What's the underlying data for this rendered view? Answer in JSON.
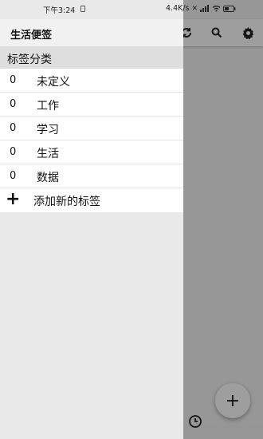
{
  "status_bar": {
    "time": "下午3:24",
    "network_speed": "4.4K/s"
  },
  "drawer": {
    "title": "生活便签",
    "section_title": "标签分类",
    "tags": [
      {
        "count": "0",
        "label": "未定义"
      },
      {
        "count": "0",
        "label": "工作"
      },
      {
        "count": "0",
        "label": "学习"
      },
      {
        "count": "0",
        "label": "生活"
      },
      {
        "count": "0",
        "label": "数据"
      }
    ],
    "add_tag_label": "添加新的标签"
  },
  "toolbar": {
    "icons": [
      "sync-icon",
      "search-icon",
      "settings-icon"
    ]
  },
  "fab": {
    "label": "+"
  }
}
